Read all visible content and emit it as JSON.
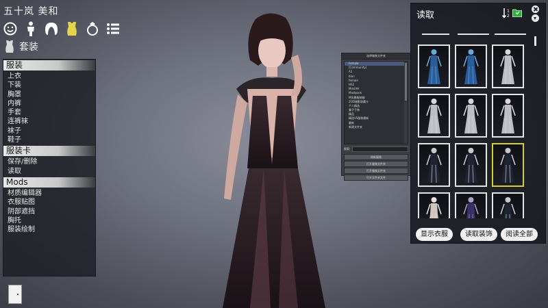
{
  "character_name": "五十岚 美和",
  "category_icons": [
    "face-icon",
    "body-icon",
    "hair-icon",
    "clothing-icon",
    "accessory-icon",
    "list-icon"
  ],
  "section_title": "套装",
  "left_menu": {
    "groups": [
      {
        "header": "服装",
        "items": [
          "上衣",
          "下装",
          "胸罩",
          "内裤",
          "手套",
          "连裤袜",
          "袜子",
          "鞋子"
        ]
      },
      {
        "header": "服装卡",
        "items": [
          "保存/删除",
          "读取"
        ]
      },
      {
        "header": "Mods",
        "items": [
          "材质编辑器",
          "衣服贴图",
          "阴部遮挡",
          "胸托",
          "服装绘制"
        ]
      }
    ]
  },
  "plugin_window": {
    "title": "选择服装文件夹",
    "tree": [
      "Female",
      "[Community]",
      "A1",
      "blan",
      "female",
      "HS2",
      "MinilAH",
      "Maidpack",
      "M风暴服装精",
      "ZOD暗影收藏卡",
      "个人精选",
      "美子子装",
      "精品",
      "精选VS服装最新",
      "最新",
      "新建文件夹"
    ],
    "search_label": "搜索:",
    "buttons": [
      "刷新服装",
      "打开服装文件夹",
      "打开服装文件夹",
      "打开文件夹文件"
    ]
  },
  "right_panel": {
    "title": "读取",
    "buttons": [
      "显示衣服",
      "读取装饰",
      "阅读全部"
    ]
  },
  "thumbnails": [
    {
      "style": "blue"
    },
    {
      "style": "blue"
    },
    {
      "style": "white"
    },
    {
      "style": "white"
    },
    {
      "style": "white"
    },
    {
      "style": "white"
    },
    {
      "style": "dark"
    },
    {
      "style": "dark"
    },
    {
      "style": "dark",
      "selected": true
    },
    {
      "style": "light"
    },
    {
      "style": "purple"
    },
    {
      "style": "dark"
    }
  ],
  "colors": {
    "selected_border": "#d4d02a",
    "folder_icon": "#2fae3a"
  }
}
